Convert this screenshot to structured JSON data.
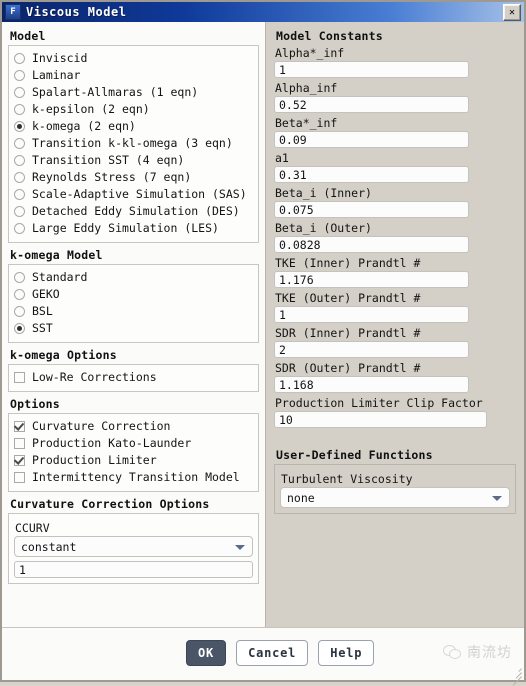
{
  "window": {
    "title": "Viscous Model",
    "icon": "fluent-f-icon",
    "close_label": "✕"
  },
  "model": {
    "group_title": "Model",
    "items": [
      {
        "label": "Inviscid",
        "selected": false
      },
      {
        "label": "Laminar",
        "selected": false
      },
      {
        "label": "Spalart-Allmaras (1 eqn)",
        "selected": false
      },
      {
        "label": "k-epsilon (2 eqn)",
        "selected": false
      },
      {
        "label": "k-omega (2 eqn)",
        "selected": true
      },
      {
        "label": "Transition k-kl-omega (3 eqn)",
        "selected": false
      },
      {
        "label": "Transition SST (4 eqn)",
        "selected": false
      },
      {
        "label": "Reynolds Stress (7 eqn)",
        "selected": false
      },
      {
        "label": "Scale-Adaptive Simulation (SAS)",
        "selected": false
      },
      {
        "label": "Detached Eddy Simulation (DES)",
        "selected": false
      },
      {
        "label": "Large Eddy Simulation (LES)",
        "selected": false
      }
    ]
  },
  "komega_model": {
    "group_title": "k-omega Model",
    "items": [
      {
        "label": "Standard",
        "selected": false
      },
      {
        "label": "GEKO",
        "selected": false
      },
      {
        "label": "BSL",
        "selected": false
      },
      {
        "label": "SST",
        "selected": true
      }
    ]
  },
  "komega_options": {
    "group_title": "k-omega Options",
    "items": [
      {
        "label": "Low-Re Corrections",
        "checked": false
      }
    ]
  },
  "options": {
    "group_title": "Options",
    "items": [
      {
        "label": "Curvature Correction",
        "checked": true
      },
      {
        "label": "Production Kato-Launder",
        "checked": false
      },
      {
        "label": "Production Limiter",
        "checked": true
      },
      {
        "label": "Intermittency Transition Model",
        "checked": false
      }
    ]
  },
  "curvature_correction_options": {
    "group_title": "Curvature Correction Options",
    "ccurv_label": "CCURV",
    "ccurv_value": "constant",
    "ccurv_number": "1"
  },
  "model_constants": {
    "group_title": "Model Constants",
    "fields": [
      {
        "label": "Alpha*_inf",
        "value": "1",
        "wide": false
      },
      {
        "label": "Alpha_inf",
        "value": "0.52",
        "wide": false
      },
      {
        "label": "Beta*_inf",
        "value": "0.09",
        "wide": false
      },
      {
        "label": "a1",
        "value": "0.31",
        "wide": false
      },
      {
        "label": "Beta_i (Inner)",
        "value": "0.075",
        "wide": false
      },
      {
        "label": "Beta_i (Outer)",
        "value": "0.0828",
        "wide": false
      },
      {
        "label": "TKE (Inner) Prandtl #",
        "value": "1.176",
        "wide": false
      },
      {
        "label": "TKE (Outer) Prandtl #",
        "value": "1",
        "wide": false
      },
      {
        "label": "SDR (Inner) Prandtl #",
        "value": "2",
        "wide": false
      },
      {
        "label": "SDR (Outer) Prandtl #",
        "value": "1.168",
        "wide": false
      },
      {
        "label": "Production Limiter Clip Factor",
        "value": "10",
        "wide": true
      }
    ]
  },
  "udf": {
    "group_title": "User-Defined Functions",
    "turbulent_viscosity_label": "Turbulent Viscosity",
    "turbulent_viscosity_value": "none"
  },
  "footer": {
    "ok_label": "OK",
    "cancel_label": "Cancel",
    "help_label": "Help",
    "watermark_text": "南流坊"
  }
}
